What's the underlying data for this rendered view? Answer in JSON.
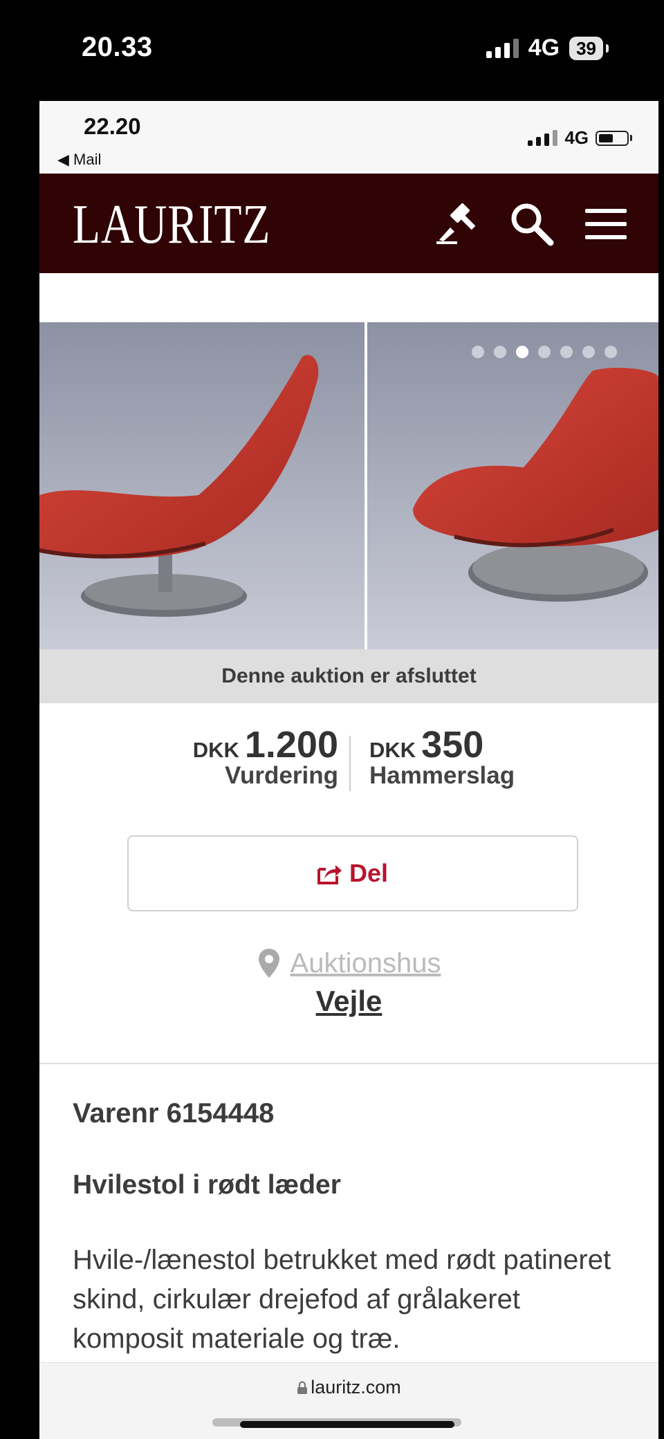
{
  "outer_status": {
    "time": "20.33",
    "network": "4G",
    "battery": "39"
  },
  "inner_status": {
    "time": "22.20",
    "back_label": "◀ Mail",
    "network": "4G"
  },
  "header": {
    "logo": "LAURITZ",
    "icons": [
      "gavel-icon",
      "search-icon",
      "menu-icon"
    ]
  },
  "carousel": {
    "slide_count": 7,
    "active_index": 2
  },
  "banner": {
    "text": "Denne auktion er afsluttet"
  },
  "prices": {
    "estimate": {
      "currency": "DKK",
      "amount": "1.200",
      "label": "Vurdering"
    },
    "hammer": {
      "currency": "DKK",
      "amount": "350",
      "label": "Hammerslag"
    }
  },
  "share": {
    "label": "Del"
  },
  "location": {
    "link_label": "Auktionshus",
    "city": "Vejle"
  },
  "item": {
    "number_label": "Varenr 6154448",
    "title": "Hvilestol i rødt læder",
    "description": "Hvile-/lænestol betrukket med rødt patineret skind, cirkulær drejefod af grålakeret komposit materiale og træ."
  },
  "browser": {
    "url": "lauritz.com"
  },
  "colors": {
    "header_bg": "#300405",
    "accent": "#b8142e"
  }
}
